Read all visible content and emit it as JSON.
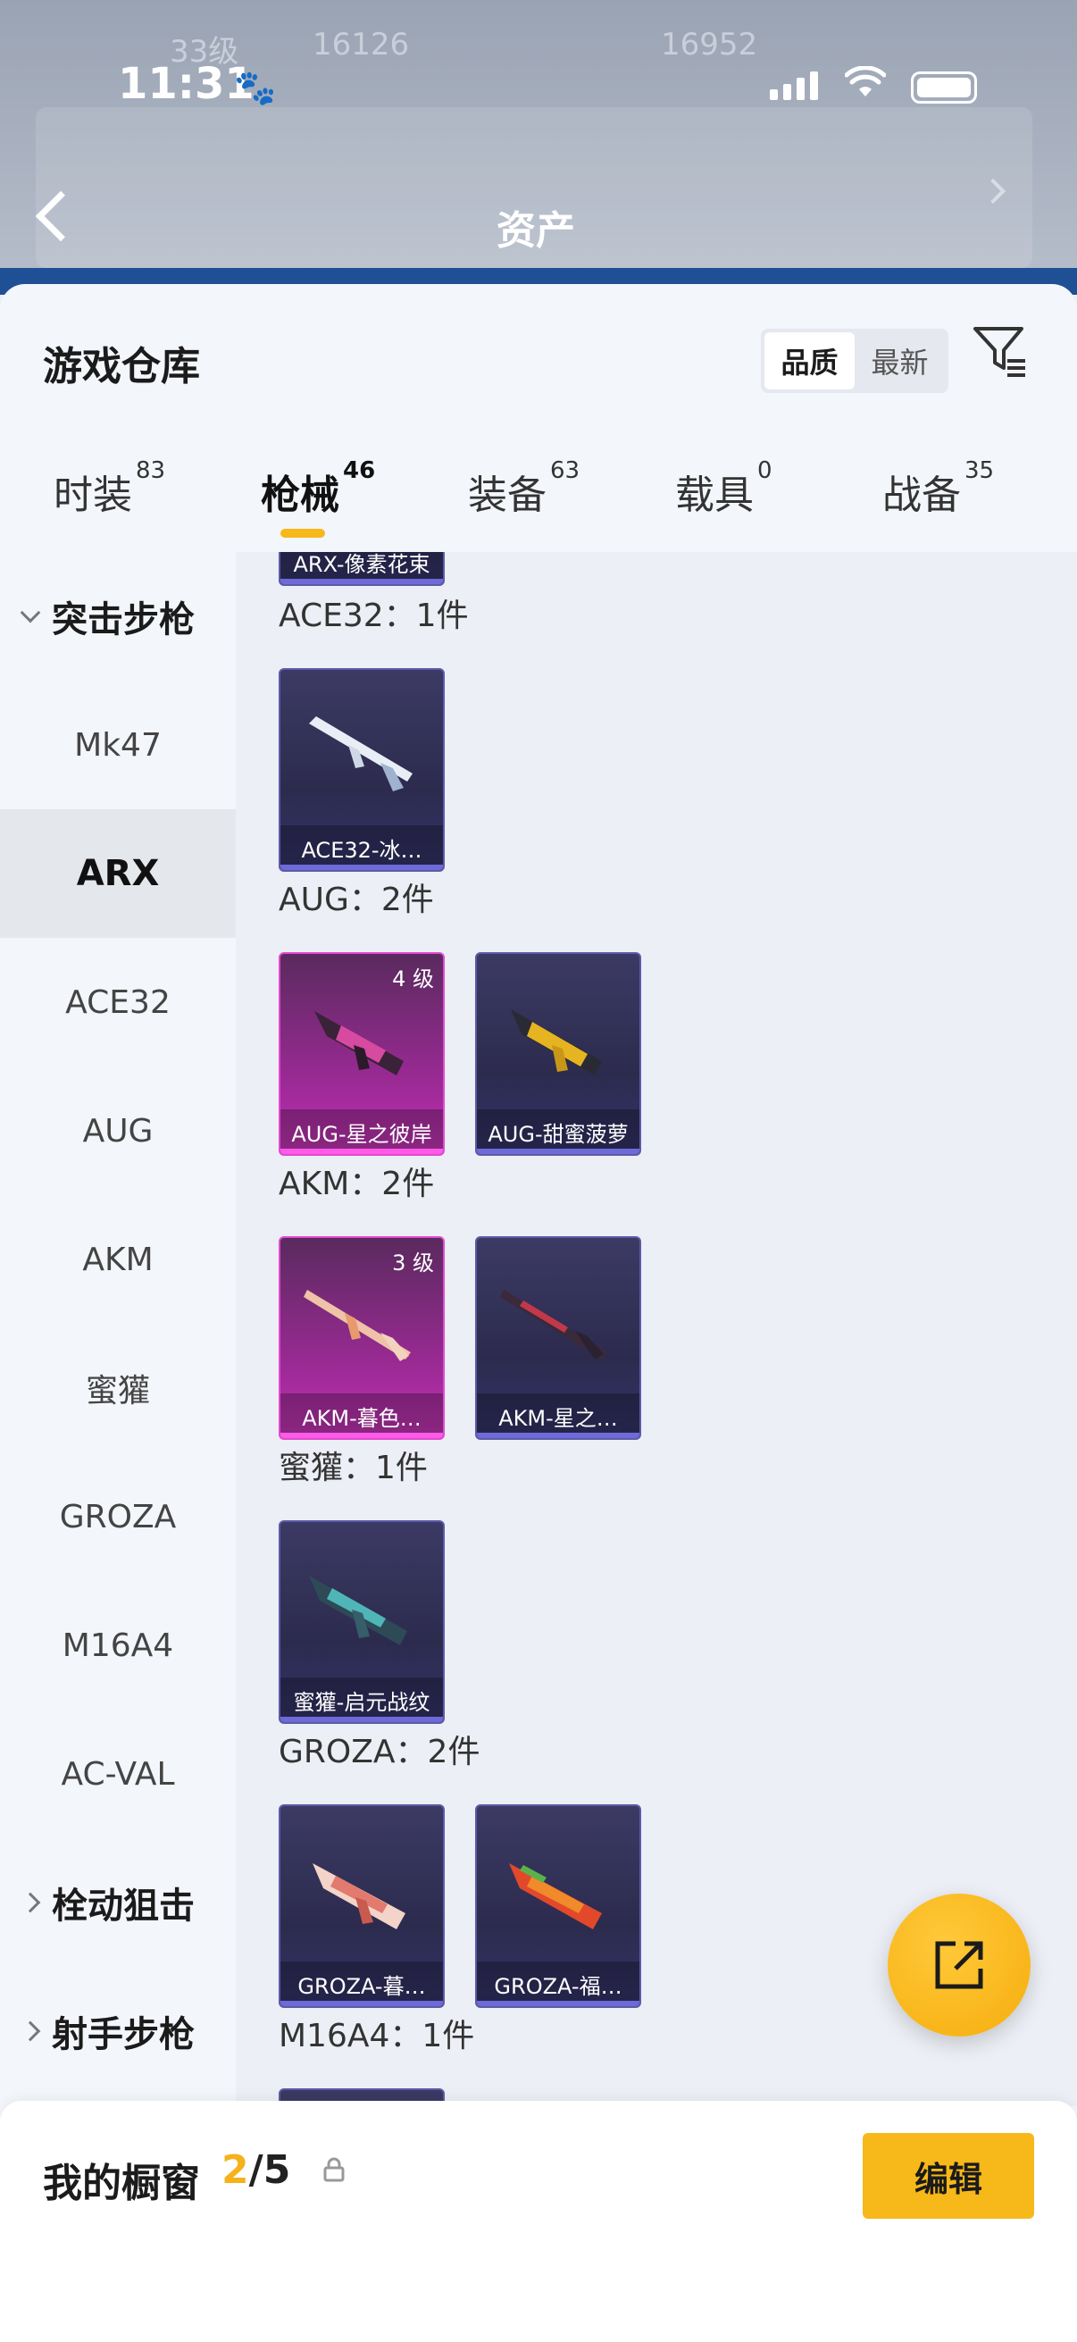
{
  "status_bar": {
    "time": "11:31",
    "paw_icon": "🐾"
  },
  "background": {
    "title": "资产",
    "ghost_texts": [
      "33级",
      "16126",
      "16952"
    ]
  },
  "sheet": {
    "title": "游戏仓库",
    "sort_options": [
      "品质",
      "最新"
    ],
    "active_sort": "品质"
  },
  "tabs": [
    {
      "label": "时装",
      "count": "83"
    },
    {
      "label": "枪械",
      "count": "46"
    },
    {
      "label": "装备",
      "count": "63"
    },
    {
      "label": "载具",
      "count": "0"
    },
    {
      "label": "战备",
      "count": "35"
    }
  ],
  "sidebar": {
    "group_assault": "突击步枪",
    "items": [
      "Mk47",
      "ARX",
      "ACE32",
      "AUG",
      "AKM",
      "蜜獾",
      "GROZA",
      "M16A4",
      "AC-VAL"
    ],
    "active_item": "ARX",
    "group_bolt": "栓动狙击",
    "group_marksman": "射手步枪"
  },
  "content": {
    "partial_top_card": "ARX-像素花束",
    "sections": [
      {
        "label": "ACE32：1件",
        "cards": [
          {
            "name": "ACE32-冰…",
            "level": "",
            "rarity": "purple"
          }
        ]
      },
      {
        "label": "AUG：2件",
        "cards": [
          {
            "name": "AUG-星之彼岸",
            "level": "4 级",
            "rarity": "pink"
          },
          {
            "name": "AUG-甜蜜菠萝",
            "level": "",
            "rarity": "purple"
          }
        ]
      },
      {
        "label": "AKM：2件",
        "cards": [
          {
            "name": "AKM-暮色…",
            "level": "3 级",
            "rarity": "pink"
          },
          {
            "name": "AKM-星之…",
            "level": "",
            "rarity": "purple"
          }
        ]
      },
      {
        "label": "蜜獾：1件",
        "cards": [
          {
            "name": "蜜獾-启元战纹",
            "level": "",
            "rarity": "purple"
          }
        ]
      },
      {
        "label": "GROZA：2件",
        "cards": [
          {
            "name": "GROZA-暮…",
            "level": "",
            "rarity": "purple"
          },
          {
            "name": "GROZA-福…",
            "level": "",
            "rarity": "purple"
          }
        ]
      },
      {
        "label": "M16A4：1件",
        "cards": []
      }
    ]
  },
  "bottom_bar": {
    "label": "我的橱窗",
    "current": "2",
    "total": "/5",
    "edit_label": "编辑"
  },
  "colors": {
    "accent": "#f7b81a",
    "purple_card": "#3c3a64",
    "pink_card": "#c436b6"
  }
}
